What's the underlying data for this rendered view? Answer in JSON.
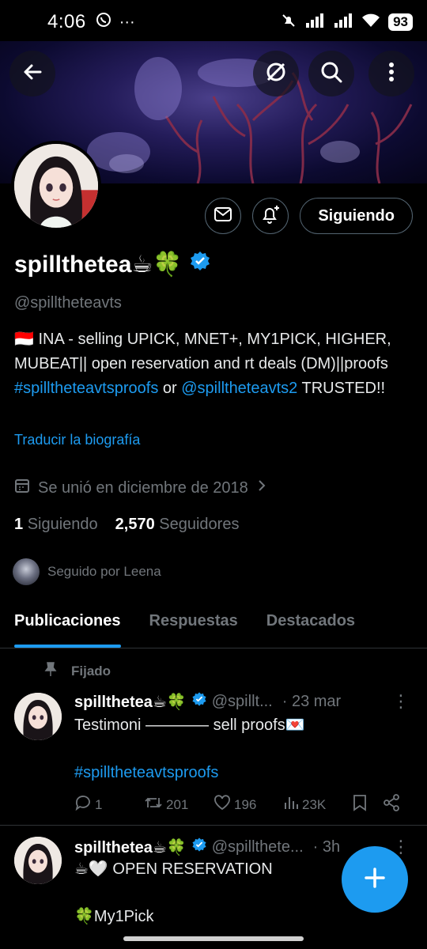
{
  "status": {
    "time": "4:06",
    "battery": "93",
    "icons": [
      "whatsapp-icon",
      "more-dots",
      "mute-icon",
      "signal-icon",
      "signal-icon",
      "wifi-icon"
    ]
  },
  "header": {
    "back_icon": "arrow-left-icon",
    "buttons": [
      "grok-icon",
      "search-icon",
      "more-vertical-icon"
    ]
  },
  "profile": {
    "name": "spillthetea☕🍀",
    "handle": "@spilltheteavts",
    "verified": true,
    "bio_flag": "🇮🇩",
    "bio_text": "INA - selling UPICK, MNET+, MY1PICK, HIGHER, MUBEAT|| open reservation and rt deals (DM)||proofs",
    "bio_link1": "#spilltheteavtsproofs",
    "bio_or": "or",
    "bio_link2": "@spilltheteavts2",
    "bio_end": "TRUSTED!!",
    "translate": "Traducir la biografía",
    "joined": "Se unió en diciembre de 2018",
    "following_count": "1",
    "following_label": "Siguiendo",
    "followers_count": "2,570",
    "followers_label": "Seguidores",
    "followed_by": "Seguido por Leena",
    "follow_button": "Siguiendo"
  },
  "tabs": [
    {
      "label": "Publicaciones",
      "active": true
    },
    {
      "label": "Respuestas",
      "active": false
    },
    {
      "label": "Destacados",
      "active": false
    }
  ],
  "posts": [
    {
      "pinned_label": "Fijado",
      "name": "spillthetea☕🍀",
      "handle": "@spillt...",
      "date": "· 23 mar",
      "line1": "Testimoni ———— sell proofs💌",
      "hashtag": "#spilltheteavtsproofs",
      "replies": "1",
      "retweets": "201",
      "likes": "196",
      "views": "23K"
    },
    {
      "name": "spillthetea☕🍀",
      "handle": "@spillthete...",
      "date": "· 3h",
      "line1": "☕🤍 OPEN RESERVATION",
      "line2": "🍀My1Pick"
    }
  ],
  "colors": {
    "accent": "#1d9bf0",
    "muted": "#71767b",
    "background": "#000000"
  }
}
